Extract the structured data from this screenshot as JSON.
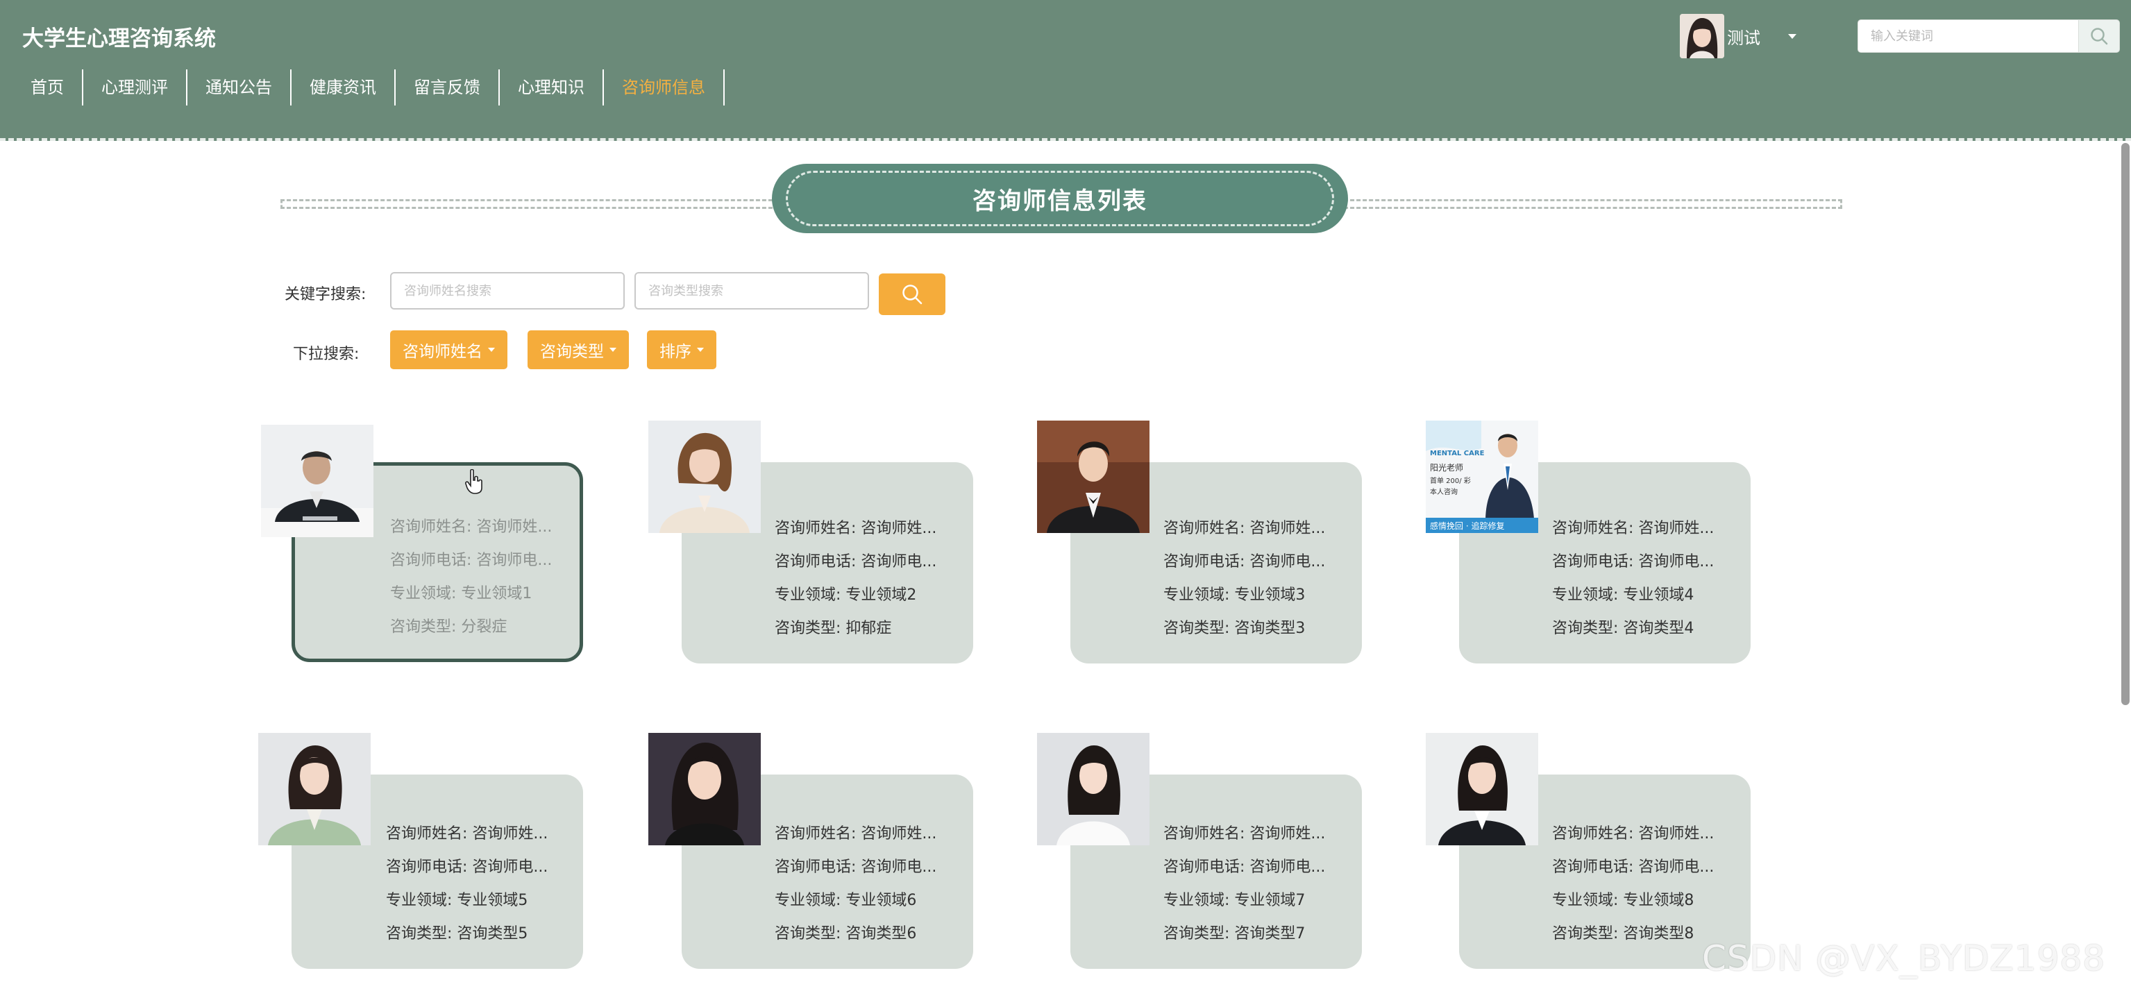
{
  "header": {
    "site_title": "大学生心理咨询系统",
    "user_name": "测试",
    "search_placeholder": "输入关键词"
  },
  "nav": {
    "items": [
      {
        "label": "首页"
      },
      {
        "label": "心理测评"
      },
      {
        "label": "通知公告"
      },
      {
        "label": "健康资讯"
      },
      {
        "label": "留言反馈"
      },
      {
        "label": "心理知识"
      },
      {
        "label": "咨询师信息",
        "active": true
      }
    ]
  },
  "section": {
    "title": "咨询师信息列表"
  },
  "filters": {
    "keyword_label": "关键字搜索:",
    "name_placeholder": "咨询师姓名搜索",
    "type_placeholder": "咨询类型搜索",
    "dropdown_label": "下拉搜索:",
    "dropdowns": [
      "咨询师姓名",
      "咨询类型",
      "排序"
    ]
  },
  "cards": [
    {
      "name": "咨询师姓名: 咨询师姓...",
      "phone": "咨询师电话: 咨询师电...",
      "field": "专业领域: 专业领域1",
      "type": "咨询类型: 分裂症"
    },
    {
      "name": "咨询师姓名: 咨询师姓...",
      "phone": "咨询师电话: 咨询师电...",
      "field": "专业领域: 专业领域2",
      "type": "咨询类型: 抑郁症"
    },
    {
      "name": "咨询师姓名: 咨询师姓...",
      "phone": "咨询师电话: 咨询师电...",
      "field": "专业领域: 专业领域3",
      "type": "咨询类型: 咨询类型3"
    },
    {
      "name": "咨询师姓名: 咨询师姓...",
      "phone": "咨询师电话: 咨询师电...",
      "field": "专业领域: 专业领域4",
      "type": "咨询类型: 咨询类型4"
    },
    {
      "name": "咨询师姓名: 咨询师姓...",
      "phone": "咨询师电话: 咨询师电...",
      "field": "专业领域: 专业领域5",
      "type": "咨询类型: 咨询类型5"
    },
    {
      "name": "咨询师姓名: 咨询师姓...",
      "phone": "咨询师电话: 咨询师电...",
      "field": "专业领域: 专业领域6",
      "type": "咨询类型: 咨询类型6"
    },
    {
      "name": "咨询师姓名: 咨询师姓...",
      "phone": "咨询师电话: 咨询师电...",
      "field": "专业领域: 专业领域7",
      "type": "咨询类型: 咨询类型7"
    },
    {
      "name": "咨询师姓名: 咨询师姓...",
      "phone": "咨询师电话: 咨询师电...",
      "field": "专业领域: 专业领域8",
      "type": "咨询类型: 咨询类型8"
    }
  ],
  "poster": {
    "line1": "MENTAL CARE",
    "line2": "阳光老师",
    "line3": "首单 200/ 彩",
    "line4": "本人咨询",
    "banner": "感情挽回 · 追踪修复"
  },
  "watermark": "CSDN @VX_BYDZ1988",
  "colors": {
    "header_bg": "#6b8a79",
    "accent": "#f5ac3b",
    "title_pill": "#5c8b7c",
    "card_bg": "#d6ddd8"
  }
}
